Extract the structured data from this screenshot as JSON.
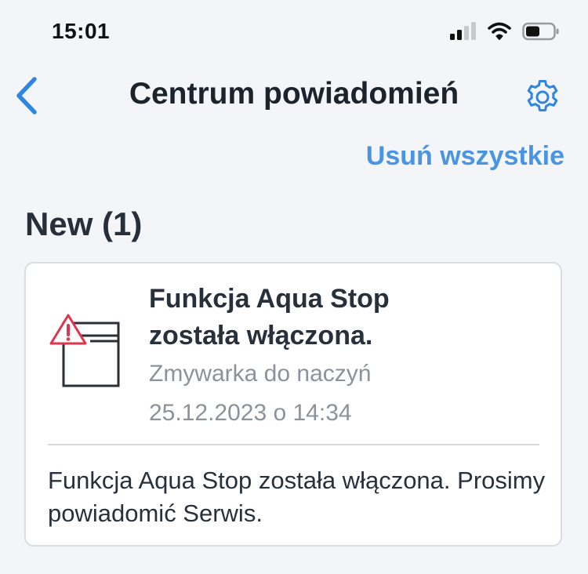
{
  "status_bar": {
    "time": "15:01",
    "icons": [
      "cellular-signal-icon",
      "wifi-icon",
      "battery-icon"
    ]
  },
  "nav": {
    "back_icon": "chevron-left-icon",
    "title": "Centrum powiadomień",
    "settings_icon": "gear-icon"
  },
  "actions": {
    "clear_all_label": "Usuń wszystkie"
  },
  "section": {
    "title": "New (1)"
  },
  "notifications": [
    {
      "icon": "dishwasher-warning-icon",
      "title": "Funkcja Aqua Stop została włączona.",
      "device": "Zmywarka do naczyń",
      "date": "25.12.2023 o 14:34",
      "body": "Funkcja Aqua Stop została włączona. Prosimy powiadomić Serwis."
    }
  ],
  "colors": {
    "accent": "#4a94e4",
    "nav_icon": "#2f86e0",
    "warning": "#e0344f",
    "background": "#f4f5f8"
  }
}
